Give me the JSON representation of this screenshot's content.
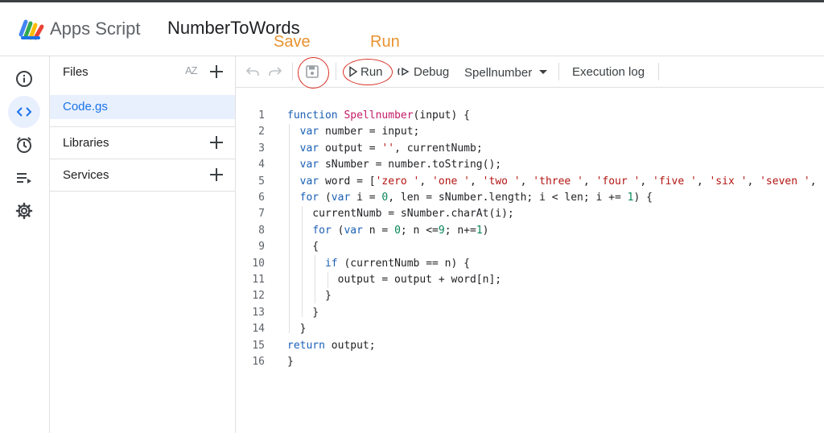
{
  "header": {
    "app_name": "Apps Script",
    "project_name": "NumberToWords"
  },
  "annotations": {
    "save": "Save",
    "run": "Run"
  },
  "rail": {
    "icons": [
      "info-icon",
      "code-icon",
      "clock-icon",
      "executions-icon",
      "gear-icon"
    ]
  },
  "files_panel": {
    "files_title": "Files",
    "sort_label": "AZ",
    "file": "Code.gs",
    "libraries": "Libraries",
    "services": "Services"
  },
  "toolbar": {
    "run_label": "Run",
    "debug_label": "Debug",
    "function_select": "Spellnumber",
    "execution_log_label": "Execution log"
  },
  "editor": {
    "line_numbers": [
      "1",
      "2",
      "3",
      "4",
      "5",
      "6",
      "7",
      "8",
      "9",
      "10",
      "11",
      "12",
      "13",
      "14",
      "15",
      "16"
    ],
    "lines": [
      "function Spellnumber(input) {",
      "  var number = input;",
      "  var output = '', currentNumb;",
      "  var sNumber = number.toString();",
      "  var word = ['zero ', 'one ', 'two ', 'three ', 'four ', 'five ', 'six ', 'seven ',",
      "  for (var i = 0, len = sNumber.length; i < len; i += 1) {",
      "    currentNumb = sNumber.charAt(i);",
      "    for (var n = 0; n <=9; n+=1)",
      "    {",
      "      if (currentNumb == n) {",
      "        output = output + word[n];",
      "      }",
      "    }",
      "  }",
      "return output;",
      "}"
    ]
  },
  "colors": {
    "accent": "#1a73e8",
    "annotation": "#e8922f",
    "circle": "#d93025",
    "keyword": "#1a5fb4",
    "function_name": "#c41a67",
    "string": "#b31412",
    "number": "#098658"
  }
}
